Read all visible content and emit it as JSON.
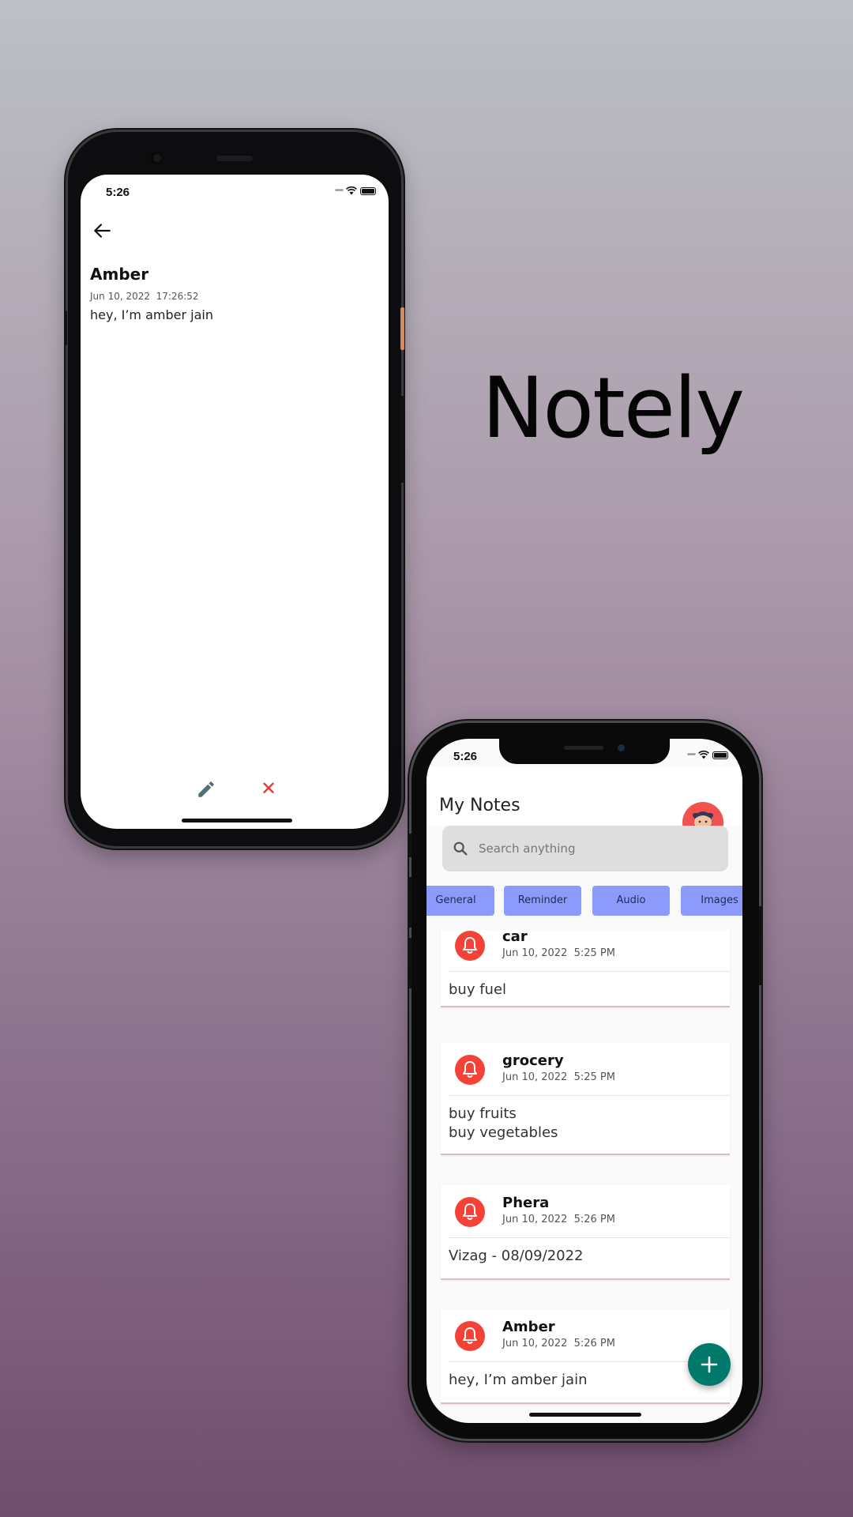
{
  "brand": {
    "name": "Notely"
  },
  "detail_screen": {
    "status_time": "5:26",
    "note": {
      "title": "Amber",
      "date": "Jun 10, 2022  17:26:52",
      "body": "hey, I’m amber jain"
    },
    "delete_symbol": "✕"
  },
  "list_screen": {
    "status_time": "5:26",
    "app_title": "My Notes",
    "search": {
      "placeholder": "Search anything"
    },
    "chips": [
      "General",
      "Reminder",
      "Audio",
      "Images"
    ],
    "notes": [
      {
        "title": "car",
        "date": "Jun 10, 2022  5:25 PM",
        "body": "buy fuel"
      },
      {
        "title": "grocery",
        "date": "Jun 10, 2022  5:25 PM",
        "body": "buy fruits\nbuy vegetables"
      },
      {
        "title": "Phera",
        "date": "Jun 10, 2022  5:26 PM",
        "body": "Vizag - 08/09/2022"
      },
      {
        "title": "Amber",
        "date": "Jun 10, 2022  5:26 PM",
        "body": "hey, I’m amber jain"
      }
    ]
  },
  "colors": {
    "chip": "#8c9bfb",
    "bell": "#f44336",
    "fab": "#00796b",
    "delete": "#e53935",
    "edit": "#546e7a"
  }
}
